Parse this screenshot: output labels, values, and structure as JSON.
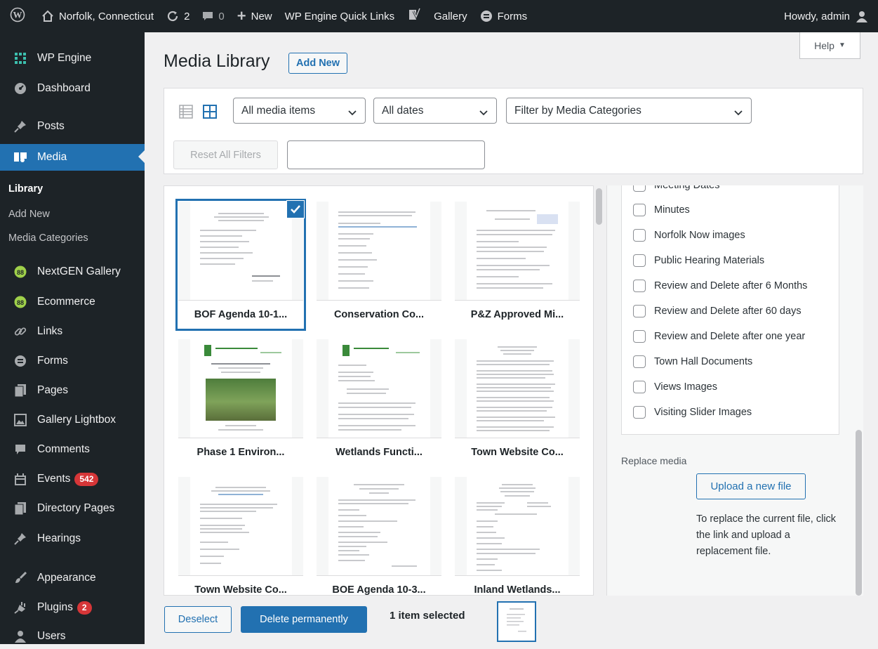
{
  "adminbar": {
    "wp_logo_icon": "wordpress-icon",
    "site_name": "Norfolk, Connecticut",
    "updates_count": "2",
    "comments_count": "0",
    "new_label": "New",
    "quick_links_label": "WP Engine Quick Links",
    "gallery_label": "Gallery",
    "forms_label": "Forms",
    "howdy": "Howdy, admin"
  },
  "sidebar": {
    "items": [
      {
        "label": "WP Engine",
        "icon": "wpengine-icon"
      },
      {
        "label": "Dashboard",
        "icon": "dashboard-icon"
      },
      {
        "label": "Posts",
        "icon": "pin-icon"
      },
      {
        "label": "Media",
        "icon": "media-icon"
      },
      {
        "label": "NextGEN Gallery",
        "icon": "nextgen-icon"
      },
      {
        "label": "Ecommerce",
        "icon": "nextgen-icon"
      },
      {
        "label": "Links",
        "icon": "link-icon"
      },
      {
        "label": "Forms",
        "icon": "forms-icon"
      },
      {
        "label": "Pages",
        "icon": "pages-icon"
      },
      {
        "label": "Gallery Lightbox",
        "icon": "gallery-icon"
      },
      {
        "label": "Comments",
        "icon": "comment-icon"
      },
      {
        "label": "Events",
        "icon": "events-icon",
        "badge": "542"
      },
      {
        "label": "Directory Pages",
        "icon": "pages-icon"
      },
      {
        "label": "Hearings",
        "icon": "pin-icon"
      },
      {
        "label": "Appearance",
        "icon": "appearance-icon"
      },
      {
        "label": "Plugins",
        "icon": "plugin-icon",
        "badge": "2"
      },
      {
        "label": "Users",
        "icon": "users-icon"
      }
    ],
    "submenu": [
      "Library",
      "Add New",
      "Media Categories"
    ]
  },
  "header": {
    "title": "Media Library",
    "add_new": "Add New",
    "help": "Help"
  },
  "toolbar": {
    "filter_type": "All media items",
    "filter_date": "All dates",
    "filter_category": "Filter by Media Categories",
    "reset": "Reset All Filters",
    "search_value": ""
  },
  "media": [
    {
      "name": "BOF Agenda 10-1..."
    },
    {
      "name": "Conservation Co..."
    },
    {
      "name": "P&Z Approved Mi..."
    },
    {
      "name": "Phase 1 Environ..."
    },
    {
      "name": "Wetlands Functi..."
    },
    {
      "name": "Town Website Co..."
    },
    {
      "name": "Town Website Co..."
    },
    {
      "name": "BOE Agenda 10-3..."
    },
    {
      "name": "Inland Wetlands..."
    }
  ],
  "details": {
    "categories": [
      "Meeting Dates",
      "Minutes",
      "Norfolk Now images",
      "Public Hearing Materials",
      "Review and Delete after 6 Months",
      "Review and Delete after 60 days",
      "Review and Delete after one year",
      "Town Hall Documents",
      "Views Images",
      "Visiting Slider Images"
    ],
    "replace_label": "Replace media",
    "upload_button": "Upload a new file",
    "replace_help": "To replace the current file, click the link and upload a replacement file."
  },
  "bottom": {
    "deselect": "Deselect",
    "delete": "Delete permanently",
    "selected": "1 item selected"
  },
  "colors": {
    "accent": "#2271b1",
    "admin_bg": "#1d2327",
    "badge": "#d63638"
  }
}
